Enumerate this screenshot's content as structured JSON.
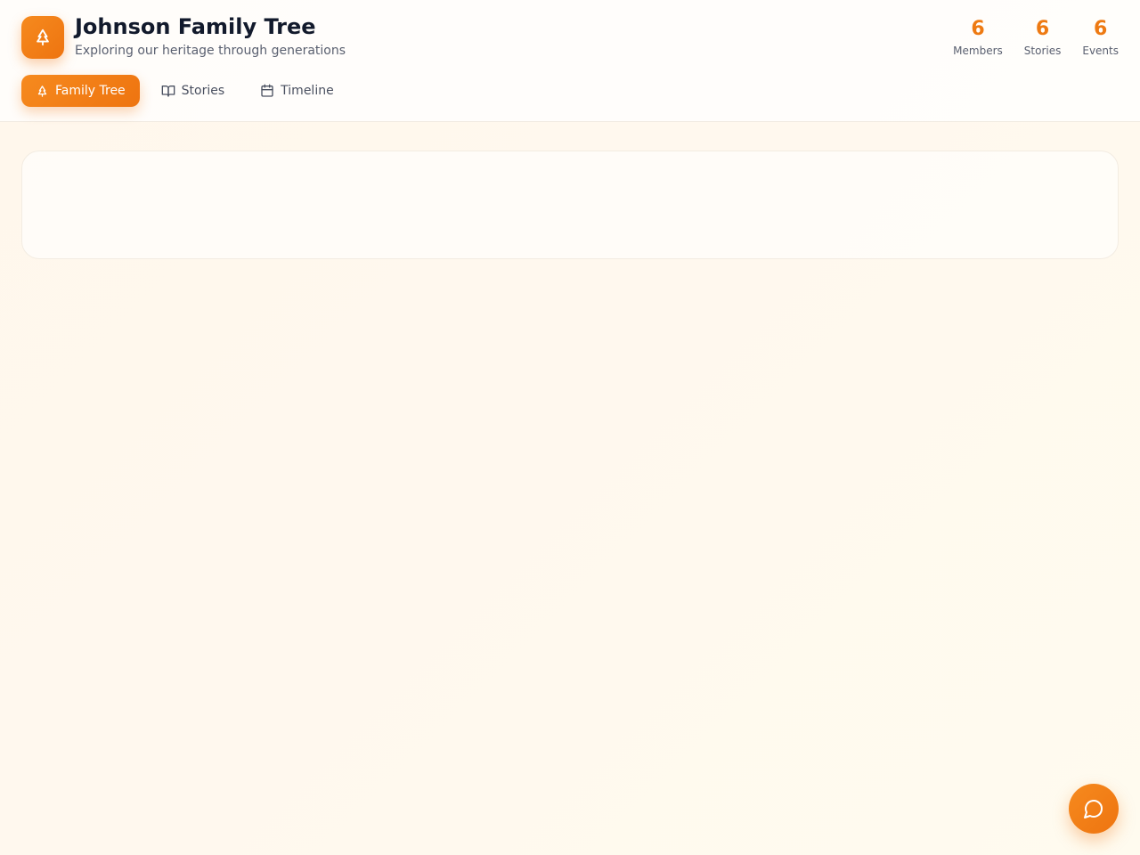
{
  "app": {
    "logo_icon": "tree-icon",
    "title": "Johnson Family Tree",
    "subtitle": "Exploring our heritage through generations",
    "accent_color": "#ee7a12"
  },
  "stats": [
    {
      "value": "6",
      "label": "Members"
    },
    {
      "value": "6",
      "label": "Stories"
    },
    {
      "value": "6",
      "label": "Events"
    }
  ],
  "tabs": [
    {
      "label": "Family Tree",
      "icon": "tree-icon",
      "active": true
    },
    {
      "label": "Stories",
      "icon": "book-icon",
      "active": false
    },
    {
      "label": "Timeline",
      "icon": "calendar-icon",
      "active": false
    }
  ],
  "chat_button": {
    "icon": "chat-bubble-icon"
  }
}
